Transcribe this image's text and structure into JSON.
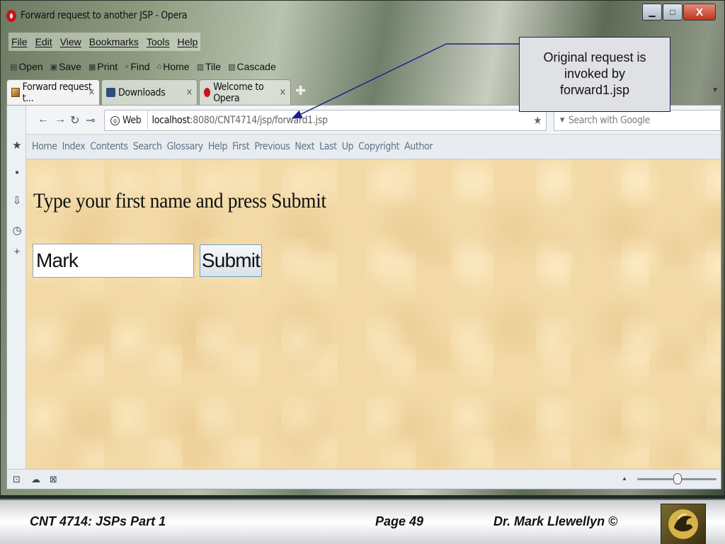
{
  "window": {
    "title": "Forward request to another JSP - Opera",
    "controls": {
      "minimize": "▁",
      "maximize": "□",
      "close": "X"
    }
  },
  "menu": [
    "File",
    "Edit",
    "View",
    "Bookmarks",
    "Tools",
    "Help"
  ],
  "toolbar": [
    {
      "label": "Open",
      "icon": "open-icon"
    },
    {
      "label": "Save",
      "icon": "save-icon"
    },
    {
      "label": "Print",
      "icon": "print-icon"
    },
    {
      "label": "Find",
      "icon": "find-icon"
    },
    {
      "label": "Home",
      "icon": "home-icon"
    },
    {
      "label": "Tile",
      "icon": "tile-icon"
    },
    {
      "label": "Cascade",
      "icon": "cascade-icon"
    }
  ],
  "tabs": [
    {
      "label": "Forward request t...",
      "close": "×",
      "active": true
    },
    {
      "label": "Downloads",
      "close": "×",
      "active": false
    },
    {
      "label": "Welcome to Opera",
      "close": "×",
      "active": false
    }
  ],
  "address": {
    "badge": "Web",
    "host": "localhost",
    "path": ":8080/CNT4714/jsp/forward1.jsp",
    "search_placeholder": "Search with Google"
  },
  "navbar": [
    "Home",
    "Index",
    "Contents",
    "Search",
    "Glossary",
    "Help",
    "First",
    "Previous",
    "Next",
    "Last",
    "Up",
    "Copyright",
    "Author"
  ],
  "page": {
    "heading": "Type your first name and press Submit",
    "input_value": "Mark",
    "submit_label": "Submit"
  },
  "callout": {
    "line1": "Original request is",
    "line2": "invoked by",
    "line3": "forward1.jsp"
  },
  "footer": {
    "course": "CNT 4714:  JSPs Part 1",
    "page": "Page 49",
    "author": "Dr. Mark Llewellyn ©"
  },
  "colors": {
    "page_background": "#f2d9a6",
    "navbar_text": "#5d7386",
    "callout_border": "#1e1e5a",
    "opera_red": "#c8141a"
  }
}
